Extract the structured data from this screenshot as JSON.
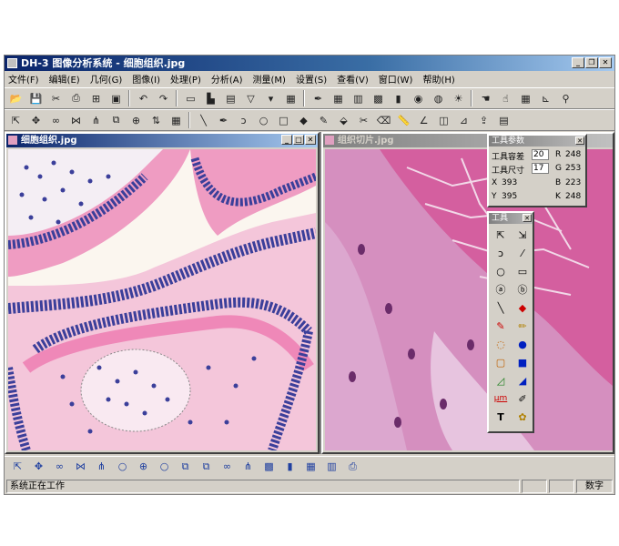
{
  "app": {
    "title": "DH-3 图像分析系统 - 细胞组织.jpg"
  },
  "menu": [
    "文件(F)",
    "编辑(E)",
    "几何(G)",
    "图像(I)",
    "处理(P)",
    "分析(A)",
    "测量(M)",
    "设置(S)",
    "查看(V)",
    "窗口(W)",
    "帮助(H)"
  ],
  "toolbar1_icons": [
    "open-icon",
    "save-icon",
    "cut-icon",
    "print-icon",
    "scan-icon",
    "capture-icon",
    "undo-icon",
    "redo-icon",
    "monitor-icon",
    "histogram-icon",
    "image-icon",
    "filter-icon",
    "dropdown-icon",
    "calculator-icon",
    "pen-icon",
    "table-icon",
    "chart-icon",
    "color-grid-icon",
    "color-bars-icon",
    "color-wheel-icon",
    "palette-icon",
    "sun-icon",
    "hand-icon",
    "pointer-icon",
    "grid-icon",
    "measure-icon",
    "magnifier-icon"
  ],
  "toolbar2_icons": [
    "select-icon",
    "move-icon",
    "link-icon",
    "join-icon",
    "split-icon",
    "copy-icon",
    "merge-icon",
    "sort-icon",
    "table-icon",
    "line-icon",
    "pen-icon",
    "lasso-icon",
    "circle-icon",
    "rectangle-icon",
    "fill-icon",
    "dropper-icon",
    "bucket-icon",
    "scissors-icon",
    "erase-icon",
    "ruler-icon",
    "angle-icon",
    "area-icon",
    "calibrate-icon",
    "export-icon",
    "report-icon"
  ],
  "windows": {
    "left_title": "细胞组织.jpg",
    "right_title": "组织切片.jpg"
  },
  "tool_params": {
    "title": "工具参数",
    "capacity_label": "工具容差",
    "capacity_value": "20",
    "size_label": "工具尺寸",
    "size_value": "17",
    "x_label": "X",
    "x_value": "393",
    "y_label": "Y",
    "y_value": "395",
    "r_label": "R",
    "r_value": "248",
    "g_label": "G",
    "g_value": "253",
    "b_label": "B",
    "b_value": "223",
    "k_label": "K",
    "k_value": "248"
  },
  "toolbox": {
    "title": "工具",
    "unit_label": "μm",
    "text_tool_glyph": "T"
  },
  "statusbar": {
    "message": "系统正在工作",
    "mode": "数字"
  }
}
